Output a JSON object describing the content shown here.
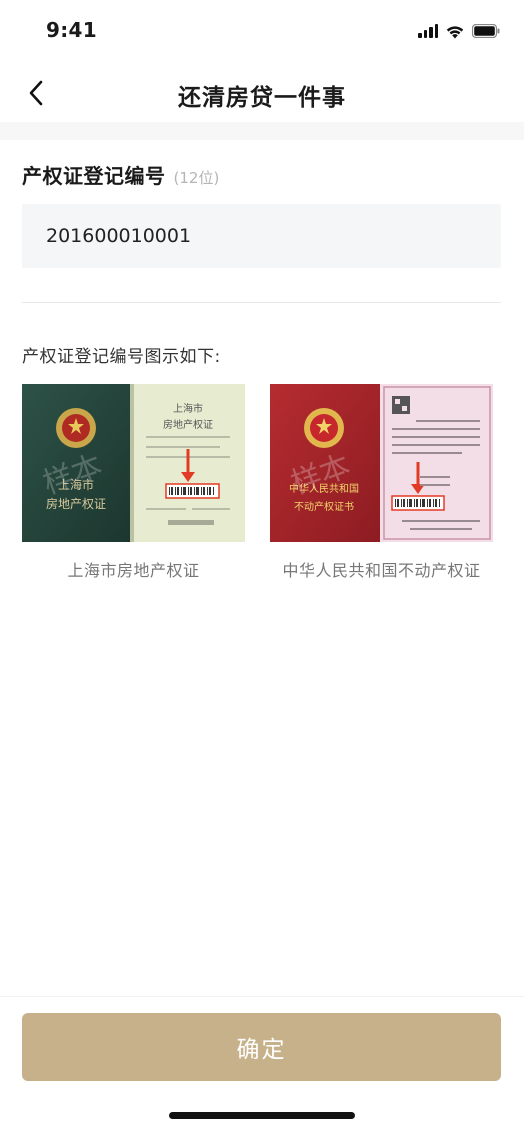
{
  "status_bar": {
    "time": "9:41",
    "icons": [
      "signal-icon",
      "wifi-icon",
      "battery-icon"
    ]
  },
  "nav": {
    "title": "还清房贷一件事",
    "back_icon": "chevron-left-icon"
  },
  "field": {
    "label": "产权证登记编号",
    "hint": "(12位)",
    "value": "201600010001"
  },
  "examples": {
    "heading": "产权证登记编号图示如下:",
    "items": [
      {
        "caption": "上海市房地产权证",
        "cover_line1": "上海市",
        "cover_line2": "房地产权证",
        "inner_line1": "上海市",
        "inner_line2": "房地产权证",
        "watermark": "样本",
        "colors": {
          "cover": "#24443a",
          "page": "#e7ecd0",
          "mark": "#e23b25"
        }
      },
      {
        "caption": "中华人民共和国不动产权证",
        "cover_line1": "中华人民共和国",
        "cover_line2": "不动产权证书",
        "watermark": "样本",
        "colors": {
          "cover": "#a52429",
          "page": "#f3dde6",
          "mark": "#e23b25"
        }
      }
    ]
  },
  "confirm": {
    "label": "确定",
    "color": "#c6b18a"
  }
}
